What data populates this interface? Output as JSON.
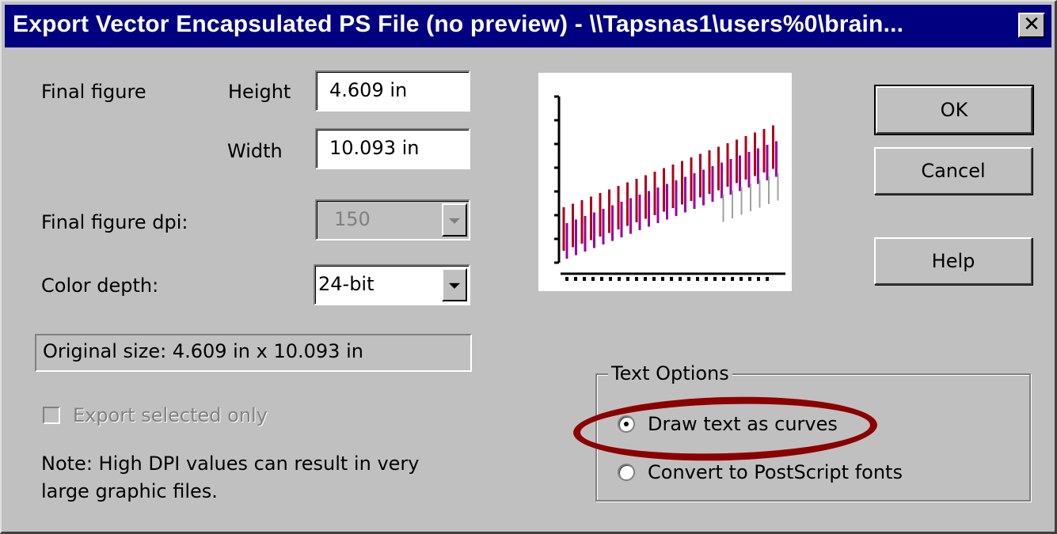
{
  "window": {
    "title": "Export Vector Encapsulated PS File (no preview) - \\\\Tapsnas1\\users%0\\brain...",
    "close_glyph": "✕"
  },
  "form": {
    "final_figure_label": "Final figure",
    "height_label": "Height",
    "height_value": "4.609 in",
    "width_label": "Width",
    "width_value": "10.093 in",
    "dpi_label": "Final figure dpi:",
    "dpi_value": "150",
    "color_depth_label": "Color depth:",
    "color_depth_value": "24-bit",
    "original_size": "Original size:  4.609 in x 10.093 in",
    "export_selected_label": "Export selected only",
    "note_line1": "Note:  High DPI values can result in very",
    "note_line2": "large graphic files."
  },
  "buttons": {
    "ok": "OK",
    "cancel": "Cancel",
    "help": "Help"
  },
  "text_options": {
    "title": "Text Options",
    "option_curves": "Draw text as curves",
    "option_fonts": "Convert to PostScript fonts",
    "selected": "curves"
  },
  "colors": {
    "titlebar": "#000080",
    "dialog_bg": "#c0c0c0",
    "annotation_circle": "#8b0000",
    "preview_series_1": "#b0001a",
    "preview_series_2": "#9b009b",
    "preview_series_3": "#a0a0a0"
  },
  "icons": [
    "close-icon",
    "dropdown-arrow-icon",
    "checkbox-icon",
    "radio-button-icon"
  ]
}
